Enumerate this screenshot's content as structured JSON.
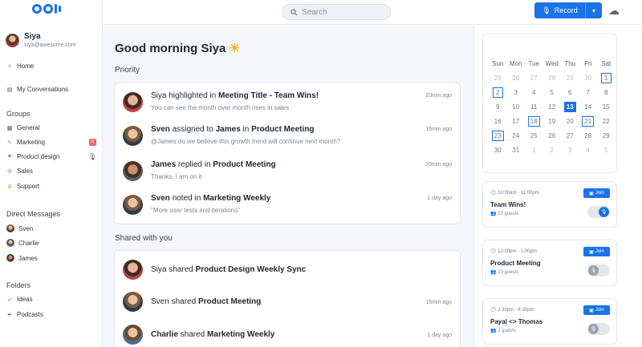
{
  "colors": {
    "accent": "#1a73e8",
    "badge": "#ef6b6b",
    "sun": "#f6b419"
  },
  "user": {
    "name": "Siya",
    "email": "siya@awesome.com"
  },
  "nav": {
    "home": "Home",
    "my_conversations": "My Conversations"
  },
  "groups": {
    "heading": "Groups",
    "items": [
      {
        "label": "General",
        "icon": "grid-icon"
      },
      {
        "label": "Marketing",
        "icon": "marketing-icon",
        "badge": "8"
      },
      {
        "label": "Product design",
        "icon": "heart-icon"
      },
      {
        "label": "Sales",
        "icon": "handshake-icon"
      },
      {
        "label": "Support",
        "icon": "crown-icon"
      }
    ]
  },
  "direct_messages": {
    "heading": "Direct Messages",
    "items": [
      "Sven",
      "Charlie",
      "James"
    ]
  },
  "folders": {
    "heading": "Folders",
    "items": [
      "Ideas",
      "Podcasts"
    ]
  },
  "header": {
    "search_placeholder": "Search",
    "record_label": "Record"
  },
  "main": {
    "greeting": "Good morning Siya",
    "priority_title": "Priority",
    "shared_title": "Shared with you",
    "priority": [
      {
        "actor": "Siya",
        "verb": "highlighted in",
        "object": "Meeting Title - Team Wins!",
        "sub": "You can see the month over month rises in sales",
        "time": "20min ago"
      },
      {
        "actor": "Sven",
        "verb": "assigned to",
        "target": "James",
        "verb2": "in",
        "object": "Product Meeting",
        "sub": "@James do we believe this growth trend will continue next month?",
        "time": "15min ago"
      },
      {
        "actor": "James",
        "verb": "replied in",
        "object": "Product Meeting",
        "sub": "Thanks, I am on it",
        "time": "20min ago"
      },
      {
        "actor": "Sven",
        "verb": "noted in",
        "object": "Marketing Weekly",
        "sub": "\"More user tests and iterations\"",
        "time": "1 day ago"
      }
    ],
    "shared": [
      {
        "actor": "Siya",
        "verb": "shared",
        "object": "Product Design Weekly Sync",
        "time": ""
      },
      {
        "actor": "Sven",
        "verb": "shared",
        "object": "Product Meeting",
        "time": "15min ago"
      },
      {
        "actor": "Charlie",
        "verb": "shared",
        "object": "Marketing Weekly",
        "time": "1 day ago"
      }
    ]
  },
  "calendar": {
    "days": [
      "Sun",
      "Mon",
      "Tue",
      "Wed",
      "Thu",
      "Fri",
      "Sat"
    ],
    "cells": [
      [
        "25",
        "dim"
      ],
      [
        "26",
        "dim"
      ],
      [
        "27",
        "dim"
      ],
      [
        "28",
        "dim"
      ],
      [
        "29",
        "dim"
      ],
      [
        "30",
        "dim"
      ],
      [
        "1",
        "mark"
      ],
      [
        "2",
        "mark"
      ],
      [
        "3",
        ""
      ],
      [
        "4",
        ""
      ],
      [
        "5",
        ""
      ],
      [
        "6",
        ""
      ],
      [
        "7",
        ""
      ],
      [
        "8",
        ""
      ],
      [
        "9",
        ""
      ],
      [
        "10",
        ""
      ],
      [
        "11",
        ""
      ],
      [
        "12",
        ""
      ],
      [
        "13",
        "today"
      ],
      [
        "14",
        ""
      ],
      [
        "15",
        ""
      ],
      [
        "16",
        ""
      ],
      [
        "17",
        ""
      ],
      [
        "18",
        "mark"
      ],
      [
        "19",
        ""
      ],
      [
        "20",
        ""
      ],
      [
        "21",
        "mark"
      ],
      [
        "22",
        ""
      ],
      [
        "23",
        "mark"
      ],
      [
        "24",
        ""
      ],
      [
        "25",
        ""
      ],
      [
        "26",
        ""
      ],
      [
        "27",
        ""
      ],
      [
        "28",
        ""
      ],
      [
        "29",
        ""
      ],
      [
        "30",
        ""
      ],
      [
        "31",
        ""
      ],
      [
        "1",
        "dim"
      ],
      [
        "2",
        "dim"
      ],
      [
        "3",
        "dim"
      ],
      [
        "4",
        "dim"
      ],
      [
        "5",
        "dim"
      ]
    ]
  },
  "meetings": [
    {
      "time": "10:00am - 11:00pm",
      "title": "Team Wins!",
      "guests": "23 guests",
      "join": "Join",
      "recording": true
    },
    {
      "time": "12:00pm - 1:00pm",
      "title": "Product Meeting",
      "guests": "10 guests",
      "join": "Join",
      "recording": false
    },
    {
      "time": "2:30pm - 4:30pm",
      "title": "Payal <> Thomas",
      "guests": "2 guests",
      "join": "Join",
      "recording": false
    }
  ]
}
